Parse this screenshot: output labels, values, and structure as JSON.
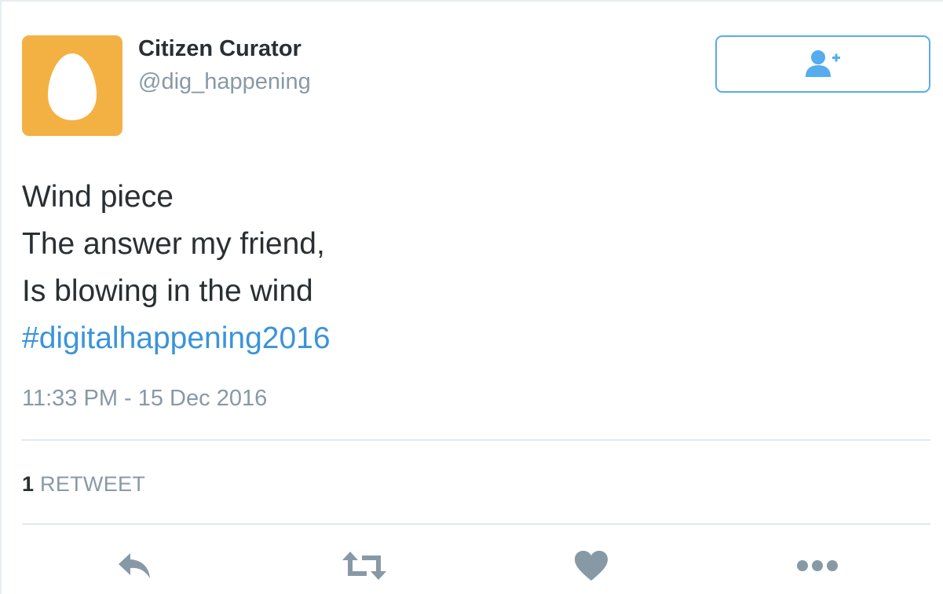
{
  "user": {
    "display_name": "Citizen Curator",
    "handle": "@dig_happening",
    "avatar_icon": "default-egg-icon",
    "avatar_color": "#f3b143"
  },
  "follow_button": {
    "icon": "follow-user-plus-icon"
  },
  "tweet": {
    "lines": [
      "Wind piece",
      "The answer my friend,",
      "Is blowing in the wind"
    ],
    "hashtag": "#digitalhappening2016",
    "timestamp": "11:33 PM - 15 Dec 2016"
  },
  "stats": {
    "retweet_count": "1",
    "retweet_label": "RETWEET"
  },
  "actions": [
    {
      "name": "reply",
      "icon": "reply-icon"
    },
    {
      "name": "retweet",
      "icon": "retweet-icon"
    },
    {
      "name": "like",
      "icon": "heart-icon"
    },
    {
      "name": "more",
      "icon": "more-dots-icon"
    }
  ],
  "colors": {
    "accent": "#55acee",
    "link": "#3b94d9",
    "text": "#292f33",
    "muted": "#8899a6",
    "action_icon": "#8899a6"
  }
}
